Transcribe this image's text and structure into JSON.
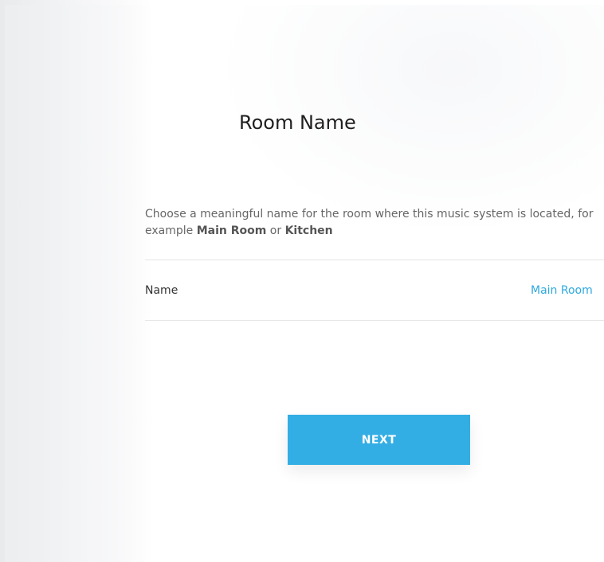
{
  "screen": {
    "title": "Room Name",
    "description": {
      "prefix": "Choose a meaningful name for the room where this music system is located, for example ",
      "example_1": "Main Room",
      "separator": " or ",
      "example_2": "Kitchen"
    },
    "name_row": {
      "label": "Name",
      "value": "Main Room"
    },
    "next_button": {
      "label": "NEXT"
    }
  },
  "colors": {
    "accent": "#33aee4",
    "link": "#2ea9df",
    "text_primary": "#1f1f1f",
    "text_secondary": "#666666",
    "divider": "#e6e6e6"
  }
}
